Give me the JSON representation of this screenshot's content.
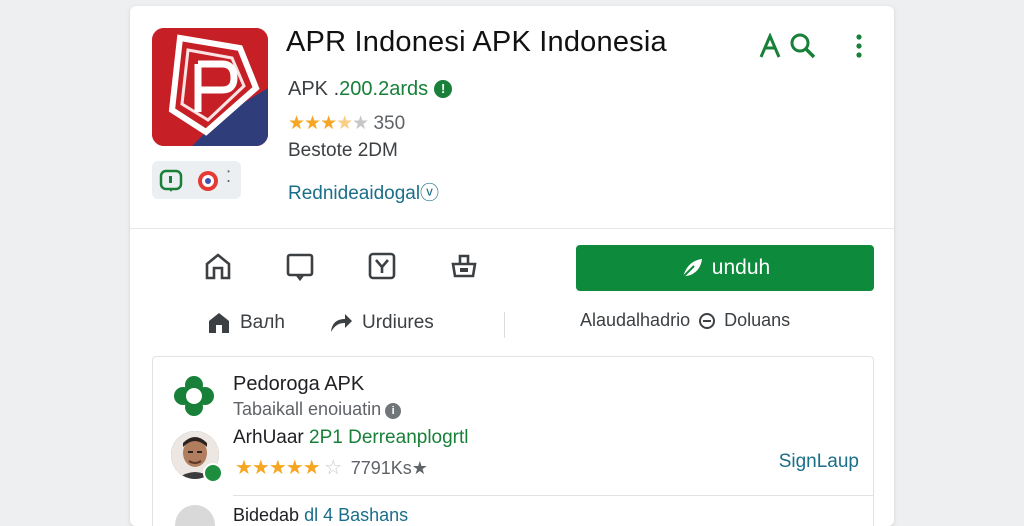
{
  "app": {
    "title": "APR Indonesi APK Indonesia",
    "apk_prefix": "APK .",
    "apk_version": "200.2ards",
    "rating_count": "350",
    "rating_stars": 3.5,
    "size_text": "Bestote 2DM",
    "developer_link": "Rednideaidogalⓥ"
  },
  "header_icons": [
    "translate-icon",
    "search-icon",
    "more-vert-icon"
  ],
  "quick_actions": [
    "home-icon",
    "tablet-icon",
    "share-box-icon",
    "basket-icon"
  ],
  "install": {
    "label": "unduh",
    "color": "#0e8a3c"
  },
  "secondary": {
    "back_label": "Baлh",
    "updates_label": "Urdiures",
    "about_label": "Alaudalhadrio",
    "download_label": "Doluans"
  },
  "panel": {
    "title": "Pedoroga APK",
    "subtitle": "Tabaikall enoiuatin",
    "reviewer_name": "ArhUaar",
    "reviewer_meta": "2P1 Derreanplogrtl",
    "review_stars": 4,
    "review_count": "7791",
    "review_count_suffix": "Ks★",
    "signup_label": "SignLaup",
    "next_name": "Bidedab",
    "next_meta": "dl 4 Bashans"
  },
  "colors": {
    "brand_green": "#0e8a3c",
    "link": "#1a6e8a",
    "star": "#f5a623",
    "icon_red": "#c62026"
  }
}
